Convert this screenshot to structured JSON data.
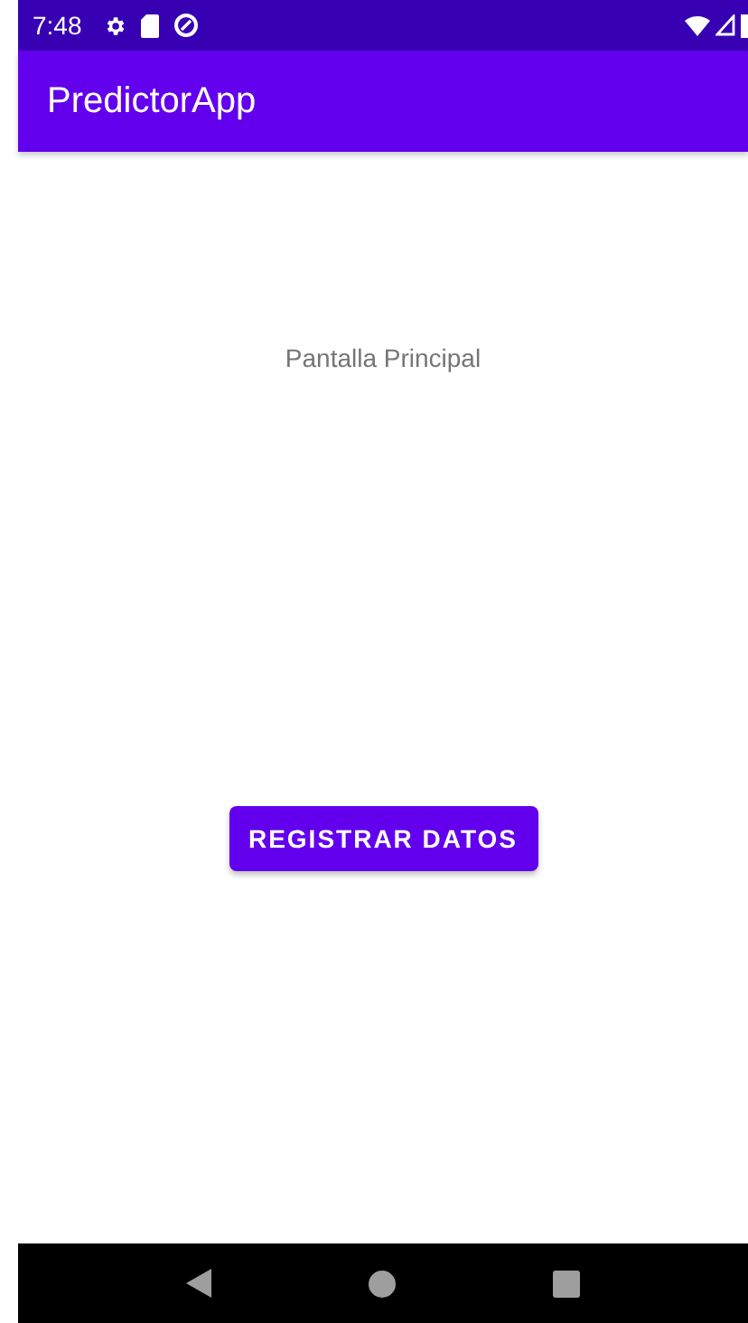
{
  "status_bar": {
    "time": "7:48"
  },
  "app_bar": {
    "title": "PredictorApp"
  },
  "content": {
    "label": "Pantalla Principal",
    "button": "REGISTRAR DATOS"
  }
}
